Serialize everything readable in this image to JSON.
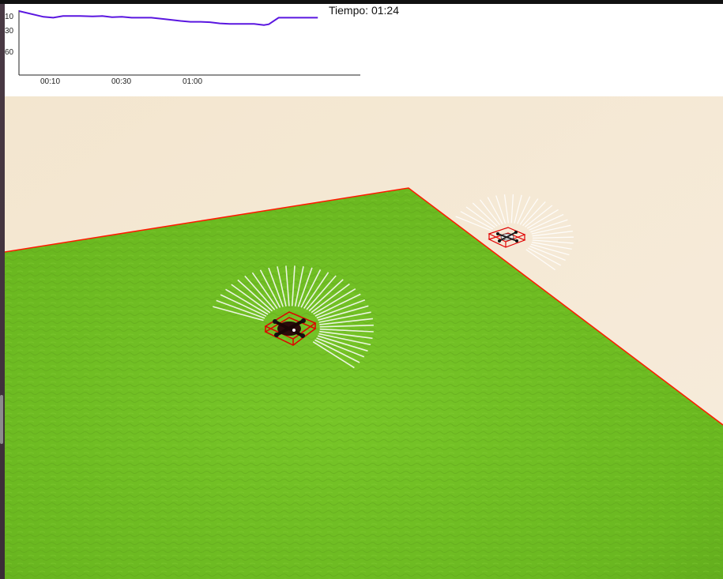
{
  "timer_label": "Tiempo: 01:24",
  "colors": {
    "series_line": "#5a16e0",
    "floor": "#6fc022",
    "background_plane": "#f2e6d0",
    "boundary_line": "#ff1a00"
  },
  "chart_data": {
    "type": "line",
    "title": "",
    "xlabel": "",
    "ylabel": "",
    "y_reversed": true,
    "x_tick_labels": [
      "00:10",
      "00:30",
      "01:00"
    ],
    "y_tick_labels": [
      "10",
      "30",
      "60"
    ],
    "ylim": [
      10,
      85
    ],
    "series": [
      {
        "points": [
          [
            0,
            11
          ],
          [
            10,
            18
          ],
          [
            14,
            19
          ],
          [
            18,
            17
          ],
          [
            25,
            17
          ],
          [
            30,
            17.5
          ],
          [
            34,
            17
          ],
          [
            38,
            18.5
          ],
          [
            42,
            18
          ],
          [
            46,
            19
          ],
          [
            50,
            19
          ],
          [
            54,
            19
          ],
          [
            60,
            21
          ],
          [
            66,
            23
          ],
          [
            70,
            24
          ],
          [
            74,
            24
          ],
          [
            78,
            24.5
          ],
          [
            82,
            26
          ],
          [
            86,
            26.5
          ],
          [
            90,
            26.5
          ],
          [
            96,
            26.5
          ],
          [
            100,
            28
          ],
          [
            102,
            27
          ],
          [
            106,
            19
          ],
          [
            110,
            19
          ],
          [
            114,
            19
          ],
          [
            118,
            19
          ],
          [
            122,
            19
          ]
        ]
      }
    ]
  },
  "scene": {
    "drones": [
      {
        "id": "drone-main",
        "color": "dark"
      },
      {
        "id": "drone-far",
        "color": "light"
      }
    ]
  }
}
